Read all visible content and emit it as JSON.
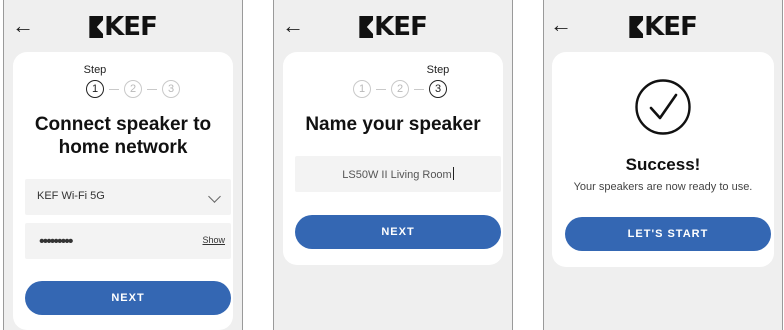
{
  "brand": {
    "logo_text": "KEF"
  },
  "icons": {
    "back": "arrow-left-icon",
    "dropdown": "chevron-down-icon",
    "success": "check-circle-icon"
  },
  "colors": {
    "accent": "#3467b3",
    "background": "#efefef",
    "card": "#ffffff"
  },
  "screen1": {
    "step_label": "Step",
    "steps": [
      "1",
      "2",
      "3"
    ],
    "active_step": 1,
    "title_line1": "Connect speaker to",
    "title_line2": "home network",
    "network_select": {
      "value": "KEF Wi-Fi 5G"
    },
    "password": {
      "masked_value": "•••••••••",
      "show_label": "Show"
    },
    "next_label": "NEXT"
  },
  "screen2": {
    "step_label": "Step",
    "steps": [
      "1",
      "2",
      "3"
    ],
    "active_step": 3,
    "title": "Name your speaker",
    "name_input": {
      "value": "LS50W II Living Room"
    },
    "next_label": "NEXT"
  },
  "screen3": {
    "title": "Success!",
    "message": "Your speakers are now ready to use.",
    "start_label": "LET'S START"
  }
}
